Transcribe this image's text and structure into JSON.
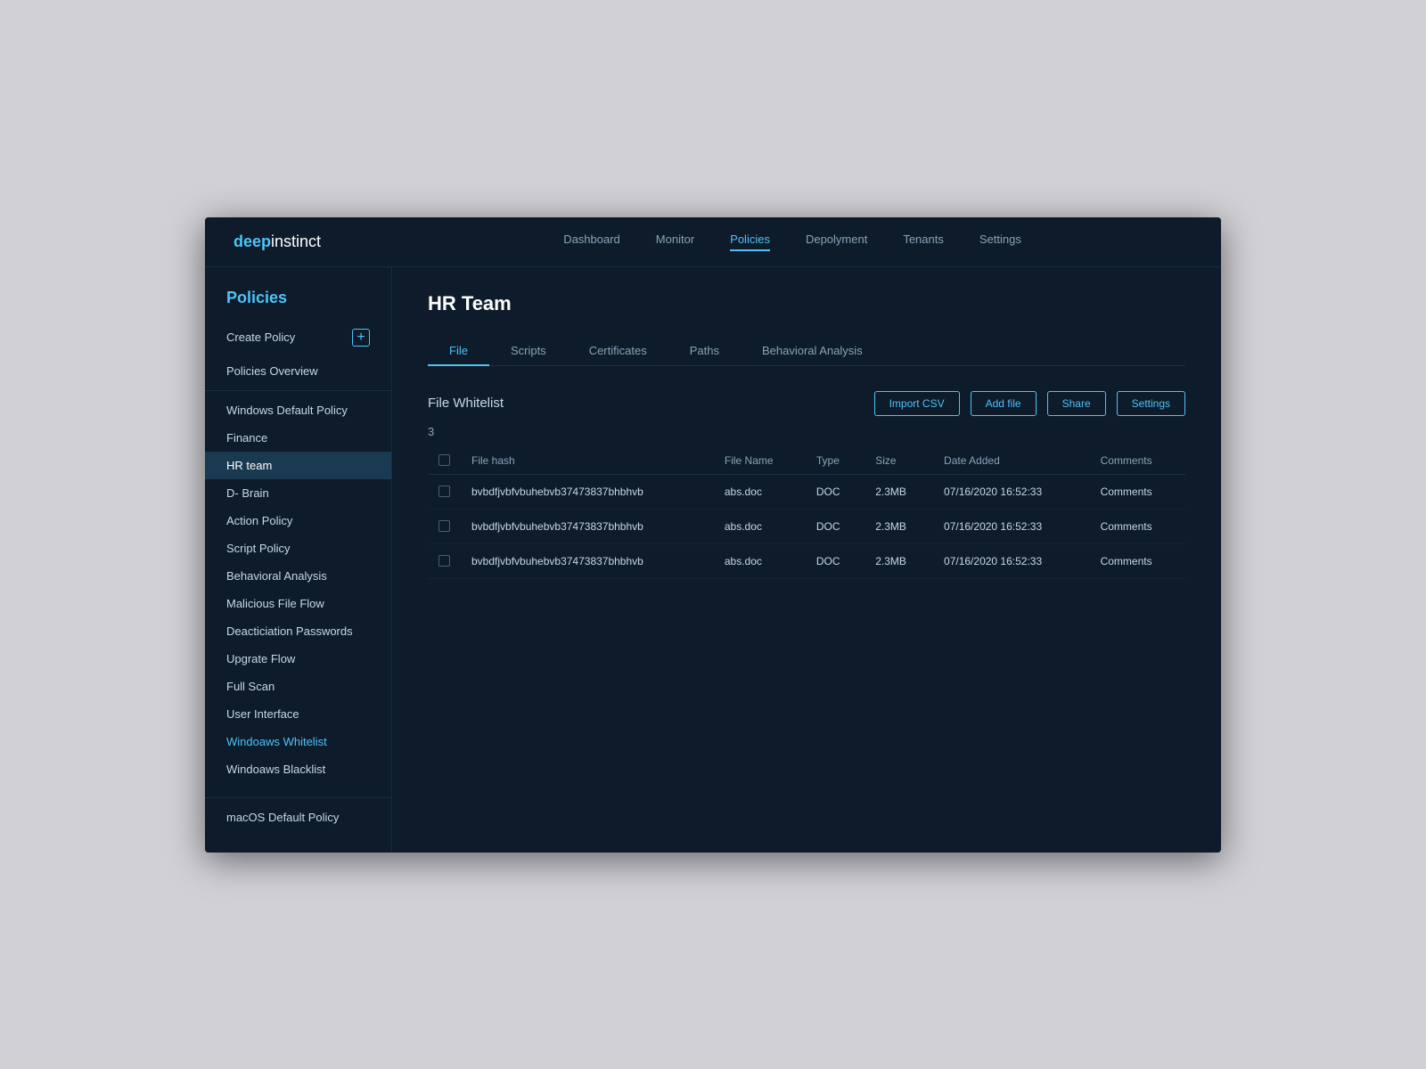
{
  "app": {
    "logo_deep": "deep",
    "logo_instinct": "instinct"
  },
  "nav": {
    "links": [
      {
        "label": "Dashboard",
        "active": false
      },
      {
        "label": "Monitor",
        "active": false
      },
      {
        "label": "Policies",
        "active": true
      },
      {
        "label": "Depolyment",
        "active": false
      },
      {
        "label": "Tenants",
        "active": false
      },
      {
        "label": "Settings",
        "active": false
      }
    ]
  },
  "sidebar": {
    "title": "Policies",
    "create_label": "Create Policy",
    "items": [
      {
        "label": "Policies Overview",
        "active": false,
        "highlight": false
      },
      {
        "label": "Windows Default Policy",
        "active": false,
        "highlight": false
      },
      {
        "label": "Finance",
        "active": false,
        "highlight": false
      },
      {
        "label": "HR team",
        "active": true,
        "highlight": false
      },
      {
        "label": "D- Brain",
        "active": false,
        "highlight": false
      },
      {
        "label": "Action Policy",
        "active": false,
        "highlight": false
      },
      {
        "label": "Script Policy",
        "active": false,
        "highlight": false
      },
      {
        "label": "Behavioral Analysis",
        "active": false,
        "highlight": false
      },
      {
        "label": "Malicious File Flow",
        "active": false,
        "highlight": false
      },
      {
        "label": "Deacticiation Passwords",
        "active": false,
        "highlight": false
      },
      {
        "label": "Upgrate Flow",
        "active": false,
        "highlight": false
      },
      {
        "label": "Full Scan",
        "active": false,
        "highlight": false
      },
      {
        "label": "User Interface",
        "active": false,
        "highlight": false
      },
      {
        "label": "Windoaws Whitelist",
        "active": false,
        "highlight": true
      },
      {
        "label": "Windoaws Blacklist",
        "active": false,
        "highlight": false
      }
    ],
    "bottom_items": [
      {
        "label": "macOS Default Policy",
        "active": false,
        "highlight": false
      }
    ]
  },
  "main": {
    "page_title": "HR Team",
    "tabs": [
      {
        "label": "File",
        "active": true
      },
      {
        "label": "Scripts",
        "active": false
      },
      {
        "label": "Certificates",
        "active": false
      },
      {
        "label": "Paths",
        "active": false
      },
      {
        "label": "Behavioral Analysis",
        "active": false
      }
    ],
    "whitelist_title": "File Whitelist",
    "count": "3",
    "buttons": {
      "import_csv": "Import CSV",
      "add_file": "Add file",
      "share": "Share",
      "settings": "Settings"
    },
    "table": {
      "columns": [
        "File hash",
        "File Name",
        "Type",
        "Size",
        "Date Added",
        "Comments"
      ],
      "rows": [
        {
          "file_hash": "bvbdfjvbfvbuhebvb37473837bhbhvb",
          "file_name": "abs.doc",
          "type": "DOC",
          "size": "2.3MB",
          "date_added": "07/16/2020 16:52:33",
          "comments": "Comments"
        },
        {
          "file_hash": "bvbdfjvbfvbuhebvb37473837bhbhvb",
          "file_name": "abs.doc",
          "type": "DOC",
          "size": "2.3MB",
          "date_added": "07/16/2020 16:52:33",
          "comments": "Comments"
        },
        {
          "file_hash": "bvbdfjvbfvbuhebvb37473837bhbhvb",
          "file_name": "abs.doc",
          "type": "DOC",
          "size": "2.3MB",
          "date_added": "07/16/2020 16:52:33",
          "comments": "Comments"
        }
      ]
    }
  }
}
